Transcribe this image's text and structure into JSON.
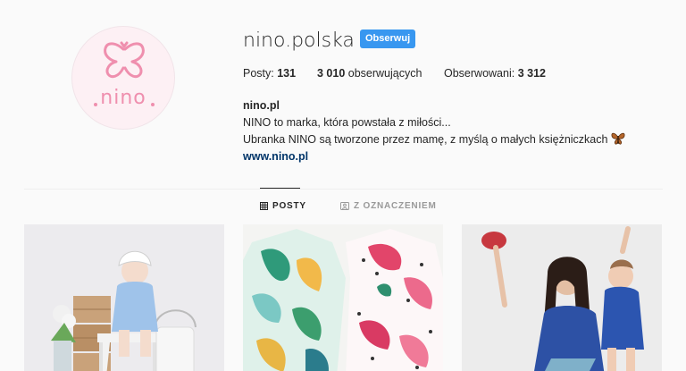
{
  "profile": {
    "avatar_text": "nino",
    "username": "nino.polska",
    "follow_label": "Obserwuj",
    "stats": {
      "posts_label": "Posty:",
      "posts_value": "131",
      "followers_value": "3 010",
      "followers_label": "obserwujących",
      "following_label": "Obserwowani:",
      "following_value": "3 312"
    },
    "bio": {
      "name": "nino.pl",
      "line1": "NINO to marka, która powstała z miłości...",
      "line2": "Ubranka NINO są tworzone przez mamę, z myślą o małych księżniczkach",
      "link": "www.nino.pl"
    }
  },
  "tabs": {
    "posts": "POSTY",
    "tagged": "Z OZNACZENIEM"
  },
  "colors": {
    "accent": "#3897f0",
    "brand_pink": "#ef8fae",
    "link": "#003569"
  },
  "icons": {
    "grid": "grid-icon",
    "tag": "tag-icon",
    "butterfly": "butterfly-emoji"
  }
}
